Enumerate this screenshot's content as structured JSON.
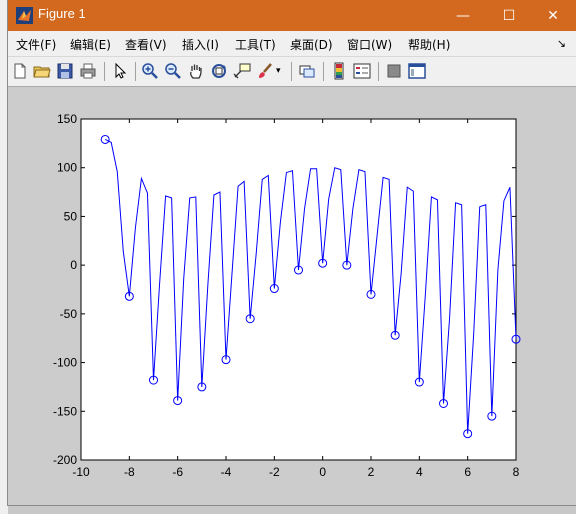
{
  "window": {
    "title": "Figure 1",
    "minimize": "—",
    "maximize": "☐",
    "close": "✕"
  },
  "menu": [
    {
      "label": "文件(F)",
      "id": "file"
    },
    {
      "label": "编辑(E)",
      "id": "edit"
    },
    {
      "label": "查看(V)",
      "id": "view"
    },
    {
      "label": "插入(I)",
      "id": "insert"
    },
    {
      "label": "工具(T)",
      "id": "tools"
    },
    {
      "label": "桌面(D)",
      "id": "desktop"
    },
    {
      "label": "窗口(W)",
      "id": "window"
    },
    {
      "label": "帮助(H)",
      "id": "help"
    }
  ],
  "toolbar": [
    "new-figure-icon",
    "open-file-icon",
    "save-icon",
    "print-icon",
    "edit-plot-arrow-icon",
    "zoom-in-icon",
    "zoom-out-icon",
    "pan-hand-icon",
    "rotate-3d-icon",
    "data-cursor-icon",
    "brush-icon",
    "brush-dropdown-icon",
    "link-plot-icon",
    "colorbar-icon",
    "legend-icon",
    "hide-plot-tools-icon",
    "show-plot-tools-icon"
  ],
  "chart_data": {
    "type": "line",
    "xlim": [
      -10,
      8
    ],
    "ylim": [
      -200,
      150
    ],
    "xticks": [
      -10,
      -8,
      -6,
      -4,
      -2,
      0,
      2,
      4,
      6,
      8
    ],
    "yticks": [
      -200,
      -150,
      -100,
      -50,
      0,
      50,
      100,
      150
    ],
    "line_color": "#0000ff",
    "marker_color": "#0000ff",
    "grid": false,
    "series": [
      {
        "style": "line",
        "x": [
          -9,
          -8.75,
          -8.5,
          -8.25,
          -8,
          -7.75,
          -7.5,
          -7.25,
          -7,
          -6.75,
          -6.5,
          -6.25,
          -6,
          -5.75,
          -5.5,
          -5.25,
          -5,
          -4.75,
          -4.5,
          -4.25,
          -4,
          -3.75,
          -3.5,
          -3.25,
          -3,
          -2.75,
          -2.5,
          -2.25,
          -2,
          -1.75,
          -1.5,
          -1.25,
          -1,
          -0.75,
          -0.5,
          -0.25,
          0,
          0.25,
          0.5,
          0.75,
          1,
          1.25,
          1.5,
          1.75,
          2,
          2.25,
          2.5,
          2.75,
          3,
          3.25,
          3.5,
          3.75,
          4,
          4.25,
          4.5,
          4.75,
          5,
          5.25,
          5.5,
          5.75,
          6,
          6.25,
          6.5,
          6.75,
          7,
          7.25,
          7.5,
          7.75,
          8
        ],
        "y": [
          129,
          126,
          96,
          14,
          -32,
          38,
          89,
          74,
          -118,
          -20,
          71,
          69,
          -139,
          -14,
          69,
          70,
          -125,
          -20,
          72,
          75,
          -97,
          -8,
          81,
          86,
          -55,
          12,
          88,
          92,
          -24,
          44,
          95,
          97,
          -5,
          58,
          99,
          99,
          2,
          68,
          100,
          98,
          0,
          58,
          98,
          96,
          -30,
          30,
          90,
          88,
          -72,
          -8,
          80,
          76,
          -120,
          -30,
          70,
          67,
          -142,
          -55,
          64,
          62,
          -173,
          -70,
          60,
          62,
          -155,
          -5,
          66,
          80,
          -76
        ]
      },
      {
        "style": "markers",
        "x": [
          -9,
          -8,
          -7,
          -6,
          -5,
          -4,
          -3,
          -2,
          -1,
          0,
          1,
          2,
          3,
          4,
          5,
          6,
          7,
          8
        ],
        "y": [
          129,
          -32,
          -118,
          -139,
          -125,
          -97,
          -55,
          -24,
          -5,
          2,
          0,
          -30,
          -72,
          -120,
          -142,
          -173,
          -155,
          -76
        ]
      }
    ]
  }
}
